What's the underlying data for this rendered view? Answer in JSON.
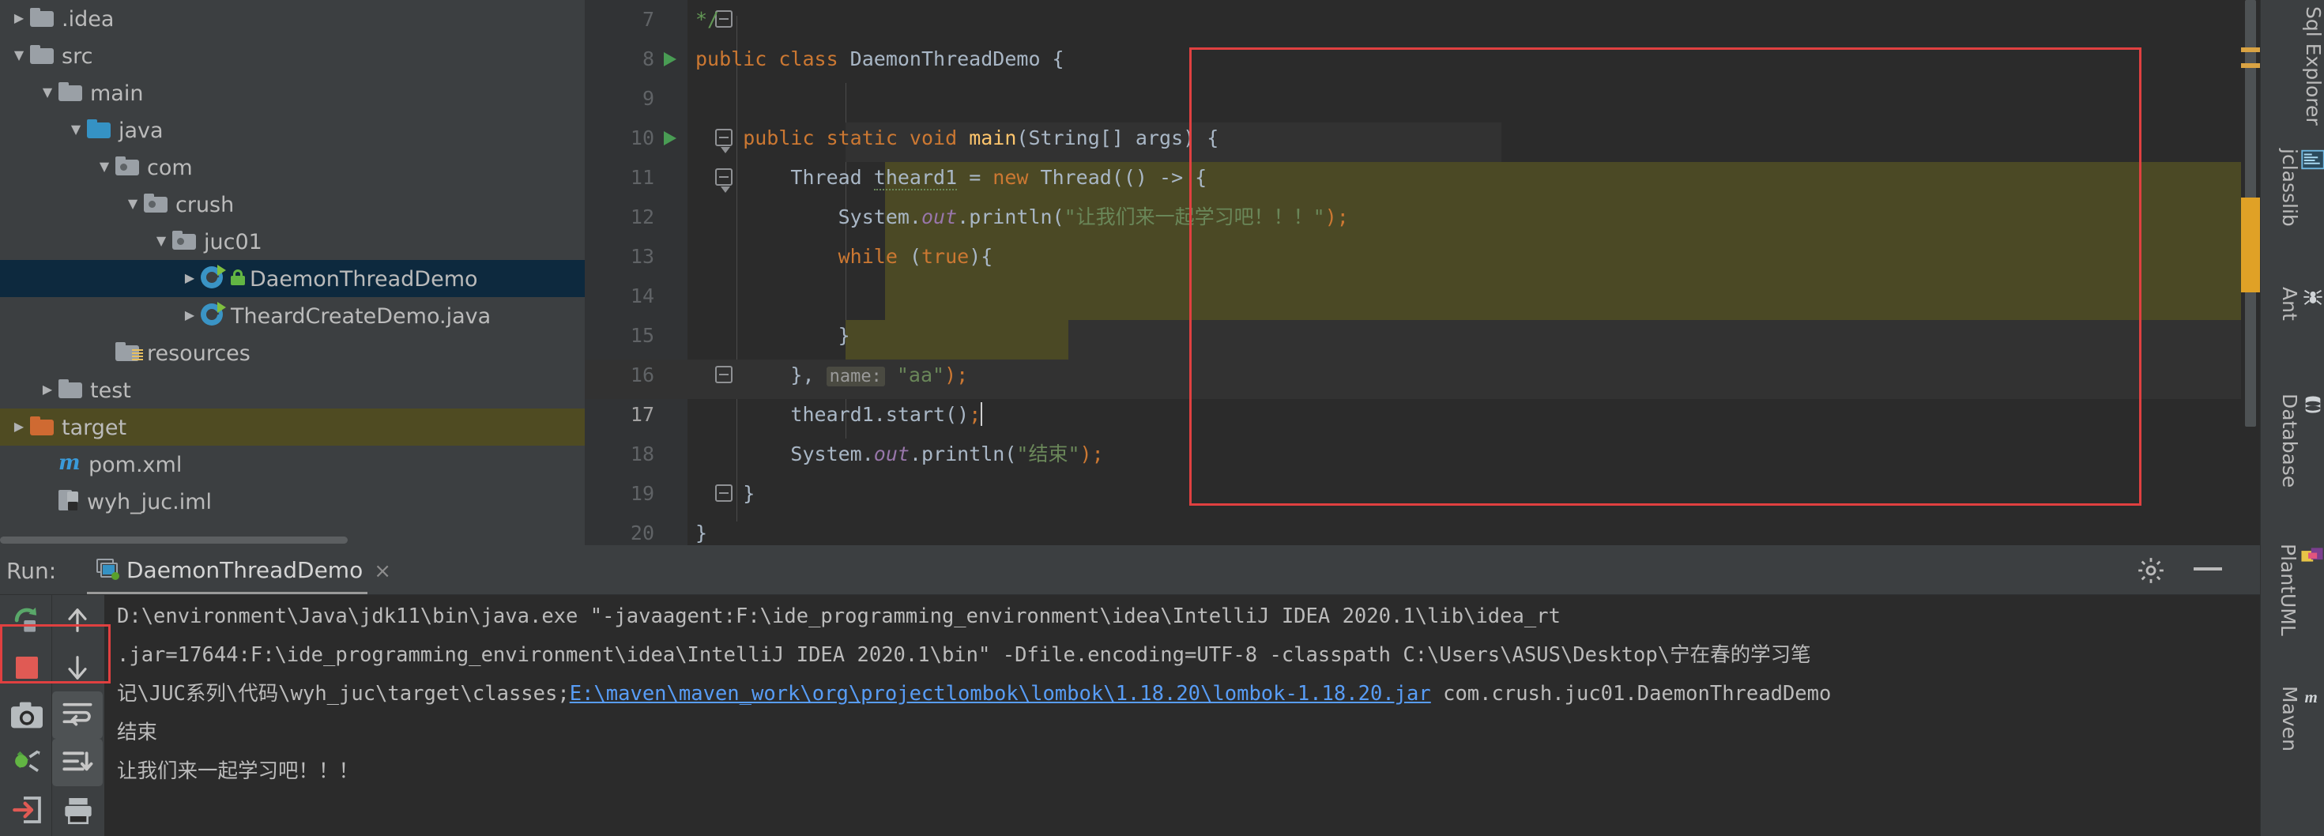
{
  "project_tree": {
    "items": [
      {
        "indent": 0,
        "twisty": "collapsed",
        "icon": "folder",
        "label": ".idea",
        "state": "normal"
      },
      {
        "indent": 0,
        "twisty": "expanded",
        "icon": "folder",
        "label": "src",
        "state": "normal"
      },
      {
        "indent": 1,
        "twisty": "expanded",
        "icon": "folder",
        "label": "main",
        "state": "normal"
      },
      {
        "indent": 2,
        "twisty": "expanded",
        "icon": "folder-blue",
        "label": "java",
        "state": "normal"
      },
      {
        "indent": 3,
        "twisty": "expanded",
        "icon": "folder-package",
        "label": "com",
        "state": "normal"
      },
      {
        "indent": 4,
        "twisty": "expanded",
        "icon": "folder-package",
        "label": "crush",
        "state": "normal"
      },
      {
        "indent": 5,
        "twisty": "expanded",
        "icon": "folder-package",
        "label": "juc01",
        "state": "normal"
      },
      {
        "indent": 6,
        "twisty": "collapsed",
        "icon": "java-class-lock",
        "label": "DaemonThreadDemo",
        "state": "selected"
      },
      {
        "indent": 6,
        "twisty": "collapsed",
        "icon": "java-class",
        "label": "TheardCreateDemo.java",
        "state": "normal"
      },
      {
        "indent": 3,
        "twisty": "none",
        "icon": "folder-resources",
        "label": "resources",
        "state": "normal"
      },
      {
        "indent": 1,
        "twisty": "collapsed",
        "icon": "folder",
        "label": "test",
        "state": "normal"
      },
      {
        "indent": 0,
        "twisty": "collapsed",
        "icon": "folder-orange",
        "label": "target",
        "state": "highlight"
      },
      {
        "indent": 1,
        "twisty": "none",
        "icon": "maven-m",
        "label": "pom.xml",
        "state": "normal"
      },
      {
        "indent": 1,
        "twisty": "none",
        "icon": "iml-module",
        "label": "wyh_juc.iml",
        "state": "normal"
      }
    ]
  },
  "editor": {
    "lines": [
      {
        "num": "7",
        "gutter": "fold-end",
        "tokens": [
          {
            "t": "*/",
            "c": "doc"
          }
        ],
        "indent": 1
      },
      {
        "num": "8",
        "gutter": "run",
        "tokens": [
          {
            "t": "public ",
            "c": "kw"
          },
          {
            "t": "class ",
            "c": "kw"
          },
          {
            "t": "DaemonThreadDemo",
            "c": "cls"
          },
          {
            "t": " {",
            "c": "txt"
          }
        ],
        "indent": 0
      },
      {
        "num": "9",
        "gutter": "",
        "tokens": [],
        "indent": 0
      },
      {
        "num": "10",
        "gutter": "run-fold",
        "tokens": [
          {
            "t": "    public static void ",
            "c": "kw"
          },
          {
            "t": "main",
            "c": "mth"
          },
          {
            "t": "(String[] args) {",
            "c": "txt"
          }
        ],
        "indent": 0
      },
      {
        "num": "11",
        "gutter": "fold",
        "tokens": [
          {
            "t": "        Thread ",
            "c": "txt"
          },
          {
            "t": "theard1",
            "c": "warn"
          },
          {
            "t": " = ",
            "c": "txt"
          },
          {
            "t": "new ",
            "c": "kw"
          },
          {
            "t": "Thread(() -> {",
            "c": "txt"
          }
        ],
        "indent": 0
      },
      {
        "num": "12",
        "gutter": "",
        "tokens": [
          {
            "t": "            System.",
            "c": "txt"
          },
          {
            "t": "out",
            "c": "fld"
          },
          {
            "t": ".println(",
            "c": "txt"
          },
          {
            "t": "\"让我们来一起学习吧！！！\"",
            "c": "str"
          },
          {
            "t": ");",
            "c": "semi"
          }
        ],
        "indent": 0
      },
      {
        "num": "13",
        "gutter": "",
        "tokens": [
          {
            "t": "            ",
            "c": "txt"
          },
          {
            "t": "while ",
            "c": "kw"
          },
          {
            "t": "(",
            "c": "txt"
          },
          {
            "t": "true",
            "c": "kw"
          },
          {
            "t": "){",
            "c": "txt"
          }
        ],
        "indent": 0
      },
      {
        "num": "14",
        "gutter": "",
        "tokens": [],
        "indent": 0
      },
      {
        "num": "15",
        "gutter": "",
        "tokens": [
          {
            "t": "            }",
            "c": "txt"
          }
        ],
        "indent": 0
      },
      {
        "num": "16",
        "gutter": "fold-end",
        "tokens": [
          {
            "t": "        }, ",
            "c": "txt"
          },
          {
            "t": "name:",
            "c": "hint"
          },
          {
            "t": " ",
            "c": "txt"
          },
          {
            "t": "\"aa\"",
            "c": "str"
          },
          {
            "t": ");",
            "c": "semi"
          }
        ],
        "indent": 0
      },
      {
        "num": "17",
        "gutter": "",
        "tokens": [
          {
            "t": "        theard1.start()",
            "c": "txt"
          },
          {
            "t": ";",
            "c": "semi"
          },
          {
            "t": "|",
            "c": "caret"
          }
        ],
        "indent": 0
      },
      {
        "num": "18",
        "gutter": "",
        "tokens": [
          {
            "t": "        System.",
            "c": "txt"
          },
          {
            "t": "out",
            "c": "fld"
          },
          {
            "t": ".println(",
            "c": "txt"
          },
          {
            "t": "\"结束\"",
            "c": "str"
          },
          {
            "t": ");",
            "c": "semi"
          }
        ],
        "indent": 0
      },
      {
        "num": "19",
        "gutter": "fold-end",
        "tokens": [
          {
            "t": "    }",
            "c": "txt"
          }
        ],
        "indent": 0
      },
      {
        "num": "20",
        "gutter": "",
        "tokens": [
          {
            "t": "}",
            "c": "txt"
          }
        ],
        "indent": 0
      }
    ]
  },
  "run_panel": {
    "run_label": "Run:",
    "tab_title": "DaemonThreadDemo",
    "tab_close": "×",
    "toolbar_icons": [
      {
        "name": "rerun-icon"
      },
      {
        "name": "scroll-up-icon"
      },
      {
        "name": "stop-icon"
      },
      {
        "name": "scroll-down-icon"
      },
      {
        "name": "screenshot-icon"
      },
      {
        "name": "soft-wrap-icon"
      },
      {
        "name": "filter-icon"
      },
      {
        "name": "scroll-to-end-icon"
      },
      {
        "name": "export-icon"
      },
      {
        "name": "print-icon"
      }
    ],
    "console_lines": [
      {
        "parts": [
          {
            "text": "D:\\environment\\Java\\jdk11\\bin\\java.exe \"-javaagent:F:\\ide_programming_environment\\idea\\IntelliJ IDEA 2020.1\\lib\\idea_rt",
            "kind": "plain"
          }
        ]
      },
      {
        "parts": [
          {
            "text": ".jar=17644:F:\\ide_programming_environment\\idea\\IntelliJ IDEA 2020.1\\bin\" -Dfile.encoding=UTF-8 -classpath C:\\Users\\ASUS\\Desktop\\宁在春的学习笔",
            "kind": "plain"
          }
        ]
      },
      {
        "parts": [
          {
            "text": "记\\JUC系列\\代码\\wyh_juc\\target\\classes;",
            "kind": "plain"
          },
          {
            "text": "E:\\maven\\maven_work\\org\\projectlombok\\lombok\\1.18.20\\lombok-1.18.20.jar",
            "kind": "link"
          },
          {
            "text": " com.crush.juc01.DaemonThreadDemo",
            "kind": "plain"
          }
        ]
      },
      {
        "parts": [
          {
            "text": "结束",
            "kind": "out"
          }
        ]
      },
      {
        "parts": [
          {
            "text": "让我们来一起学习吧！！！",
            "kind": "out"
          }
        ]
      }
    ],
    "settings_icon": "gear-icon",
    "minimize_icon": "minimize-icon"
  },
  "right_bar": {
    "items": [
      {
        "label": "Sql Explorer",
        "icon": "sql-explorer-icon"
      },
      {
        "label": "jclasslib",
        "icon": "jclasslib-icon"
      },
      {
        "label": "Ant",
        "icon": "ant-icon"
      },
      {
        "label": "Database",
        "icon": "database-icon"
      },
      {
        "label": "PlantUML",
        "icon": "plantuml-icon"
      },
      {
        "label": "Maven",
        "icon": "maven-icon"
      }
    ]
  },
  "colors": {
    "background": "#3c3f41",
    "editor_bg": "#2b2b2b",
    "selection_blue": "#0d293e",
    "highlight_olive": "#4b4925",
    "keyword_orange": "#cc7832",
    "string_green": "#6a8759",
    "method_yellow": "#ffc66d",
    "field_purple": "#9876aa",
    "text_grey": "#a9b7c6",
    "link_blue": "#589df6",
    "red_annotation": "#e04040",
    "folder_blue": "#3592c4",
    "folder_orange": "#cf6a32"
  }
}
